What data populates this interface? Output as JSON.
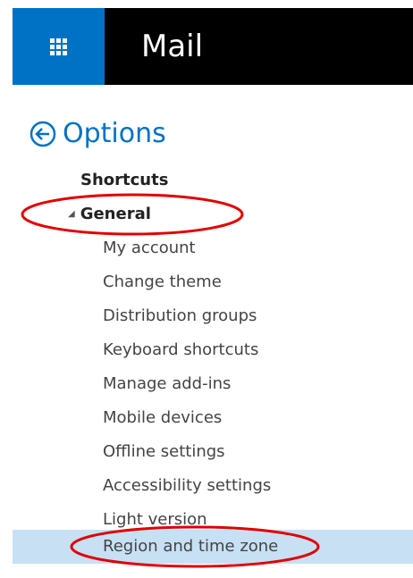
{
  "header": {
    "app_name": "Mail",
    "launcher_icon": "waffle-grid-icon",
    "bar_color": "#000000",
    "launcher_color": "#0072c6"
  },
  "options": {
    "back_icon": "back-arrow-circle-icon",
    "title": "Options",
    "accent_color": "#0072c6"
  },
  "nav": {
    "shortcuts": "Shortcuts",
    "general": "General",
    "general_expanded": true,
    "general_items": [
      "My account",
      "Change theme",
      "Distribution groups",
      "Keyboard shortcuts",
      "Manage add-ins",
      "Mobile devices",
      "Offline settings",
      "Accessibility settings",
      "Light version",
      "Region and time zone"
    ],
    "selected_item": "Region and time zone",
    "selected_color": "#c7e0f4"
  },
  "annotations": {
    "ellipse_color": "#e00000",
    "highlighted": [
      "General",
      "Region and time zone"
    ]
  }
}
